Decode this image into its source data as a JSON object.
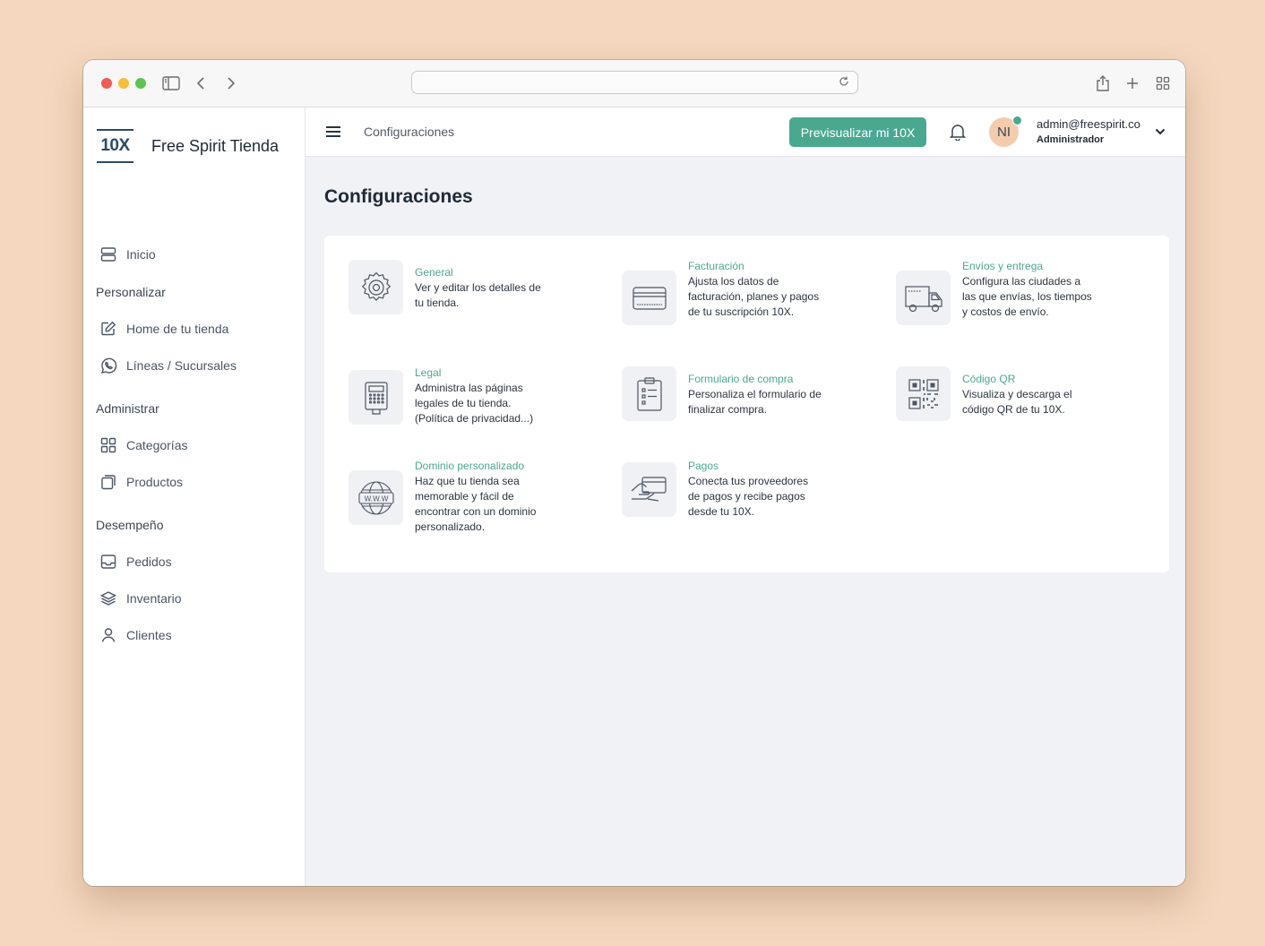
{
  "browser": {
    "url": ""
  },
  "sidebar": {
    "logo_text": "10X",
    "store_name": "Free Spirit Tienda",
    "home": {
      "label": "Inicio",
      "icon": "layers-icon"
    },
    "sections": [
      {
        "title": "Personalizar",
        "items": [
          {
            "label": "Home de tu tienda",
            "icon": "edit-icon"
          },
          {
            "label": "Líneas / Sucursales",
            "icon": "whatsapp-icon"
          }
        ]
      },
      {
        "title": "Administrar",
        "items": [
          {
            "label": "Categorías",
            "icon": "grid-icon"
          },
          {
            "label": "Productos",
            "icon": "copy-icon"
          }
        ]
      },
      {
        "title": "Desempeño",
        "items": [
          {
            "label": "Pedidos",
            "icon": "inbox-icon"
          },
          {
            "label": "Inventario",
            "icon": "stack-icon"
          },
          {
            "label": "Clientes",
            "icon": "user-icon"
          }
        ]
      }
    ]
  },
  "topbar": {
    "breadcrumb": "Configuraciones",
    "preview_button": "Previsualizar mi 10X",
    "avatar_initials": "NI",
    "user_email": "admin@freespirit.co",
    "user_role": "Administrador"
  },
  "main": {
    "title": "Configuraciones",
    "settings": [
      {
        "title": "General",
        "description": "Ver y editar los detalles de tu tienda.",
        "icon": "gear-icon"
      },
      {
        "title": "Facturación",
        "description": "Ajusta los datos de facturación, planes y pagos de tu suscripción 10X.",
        "icon": "credit-card-icon"
      },
      {
        "title": "Envíos y entrega",
        "description": "Configura las ciudades a las que envías, los tiempos y costos de envío.",
        "icon": "truck-icon"
      },
      {
        "title": "Legal",
        "description": "Administra las páginas legales de tu tienda. (Política de privacidad...)",
        "icon": "calculator-icon"
      },
      {
        "title": "Formulario de compra",
        "description": "Personaliza el formulario de finalizar compra.",
        "icon": "clipboard-icon"
      },
      {
        "title": "Código QR",
        "description": "Visualiza y descarga el código QR de tu 10X.",
        "icon": "qr-code-icon"
      },
      {
        "title": "Dominio personalizado",
        "description": "Haz que tu tienda sea memorable y fácil de encontrar con un dominio personalizado.",
        "icon": "www-globe-icon",
        "icon_text": "W.W.W"
      },
      {
        "title": "Pagos",
        "description": "Conecta tus proveedores de pagos y recibe pagos desde tu 10X.",
        "icon": "hand-card-icon"
      }
    ]
  },
  "colors": {
    "accent": "#4aa890",
    "background": "#f4d7be",
    "avatar_bg": "#f3ccae"
  }
}
